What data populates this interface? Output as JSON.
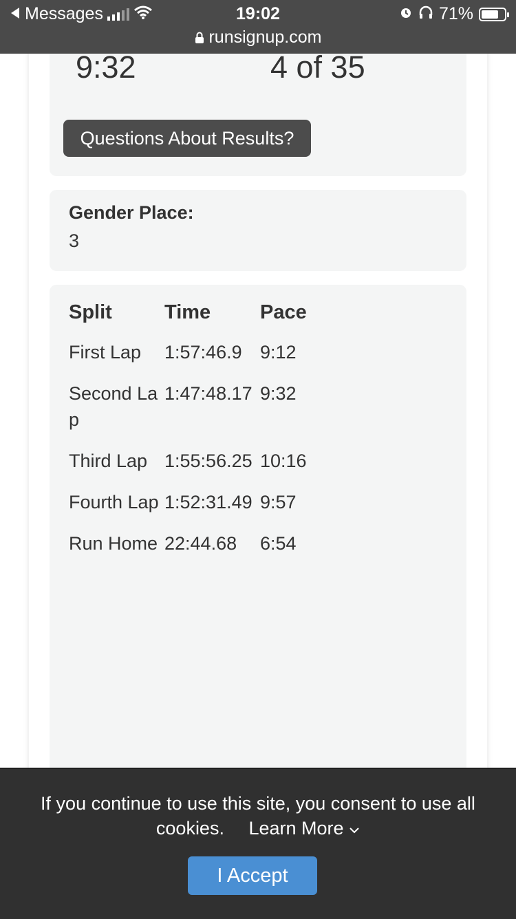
{
  "status_bar": {
    "back_label": "Messages",
    "time": "19:02",
    "battery": "71%",
    "url": "runsignup.com"
  },
  "summary": {
    "pace": "9:32",
    "place": "4 of 35",
    "questions_button": "Questions About Results?"
  },
  "gender": {
    "label": "Gender Place:",
    "value": "3"
  },
  "splits": {
    "headers": [
      "Split",
      "Time",
      "Pace"
    ],
    "rows": [
      {
        "split": "First Lap",
        "time": "1:57:46.9",
        "pace": "9:12"
      },
      {
        "split": "Second Lap",
        "time": "1:47:48.17",
        "pace": "9:32"
      },
      {
        "split": "Third Lap",
        "time": "1:55:56.25",
        "pace": "10:16"
      },
      {
        "split": "Fourth Lap",
        "time": "1:52:31.49",
        "pace": "9:57"
      },
      {
        "split": "Run Home",
        "time": "22:44.68",
        "pace": "6:54"
      }
    ]
  },
  "cookie": {
    "message": "If you continue to use this site, you consent to use all cookies.",
    "learn_more": "Learn More",
    "accept": "I Accept"
  }
}
